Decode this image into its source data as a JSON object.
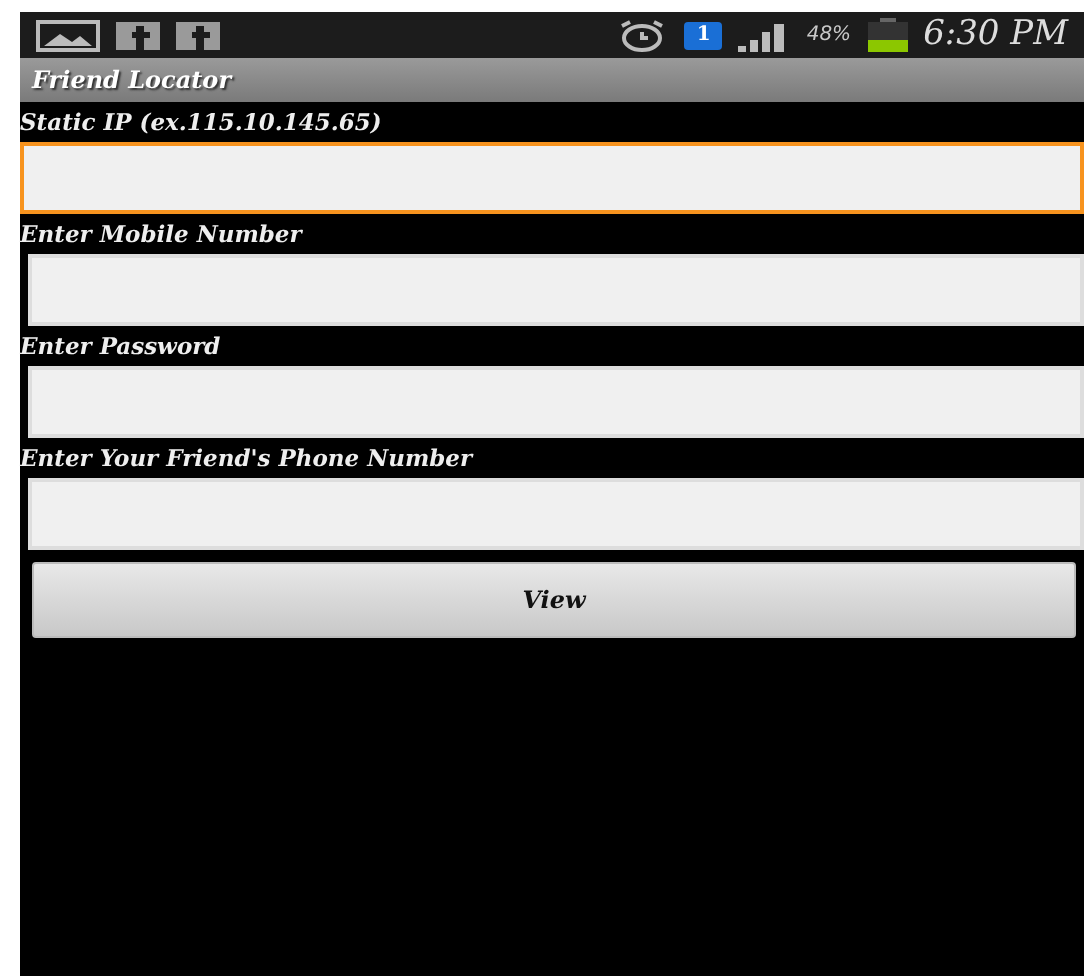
{
  "status_bar": {
    "notification_count": "1",
    "battery": "48%",
    "time": "6:30 PM"
  },
  "title_bar": {
    "title": "Friend Locator"
  },
  "fields": [
    {
      "label": "Static IP (ex.115.10.145.65)",
      "focused": true
    },
    {
      "label": "Enter Mobile Number",
      "focused": false
    },
    {
      "label": "Enter Password",
      "focused": false
    },
    {
      "label": "Enter Your Friend's Phone Number",
      "focused": false
    }
  ],
  "button": {
    "label": "View"
  }
}
